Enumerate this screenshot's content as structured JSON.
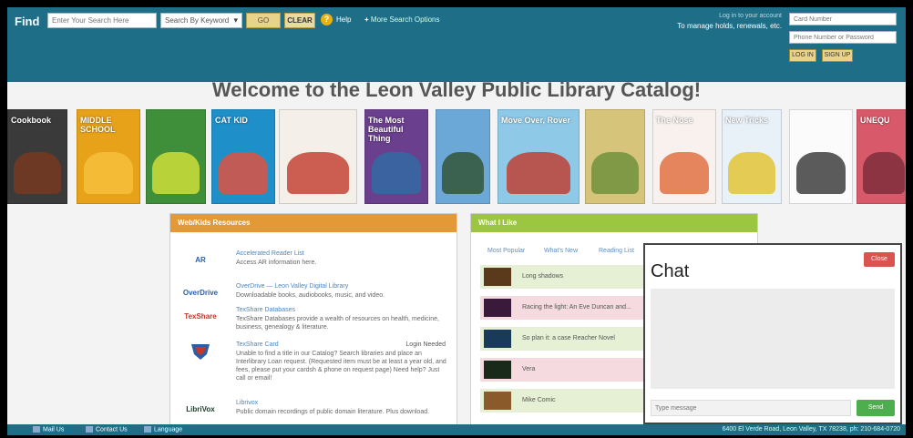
{
  "header": {
    "find_label": "Find",
    "search_placeholder": "Enter Your Search Here",
    "search_by": "Search By Keyword",
    "go_label": "GO",
    "clear_label": "CLEAR",
    "help_label": "Help",
    "more_search_label": "More Search Options",
    "account_line1": "Log in to your account",
    "account_line2": "To manage holds, renewals, etc.",
    "user_placeholder": "Card Number",
    "pass_placeholder": "Phone Number or Password",
    "login_label": "LOG IN",
    "signup_label": "SIGN UP"
  },
  "welcome": "Welcome to the Leon Valley Public Library Catalog!",
  "books": [
    {
      "title": "Cookbook",
      "color": "#3a3a3a",
      "accent": "#7a3a20"
    },
    {
      "title": "MIDDLE SCHOOL",
      "color": "#e8a21a",
      "accent": "#f6c23e"
    },
    {
      "title": "",
      "color": "#3f8f3a",
      "accent": "#d7e23a"
    },
    {
      "title": "CAT KID",
      "color": "#1f8fc9",
      "accent": "#e94e3a"
    },
    {
      "title": "",
      "color": "#f4efe8",
      "accent": "#c0392b"
    },
    {
      "title": "The Most Beautiful Thing",
      "color": "#6a3f8e",
      "accent": "#2e6da4"
    },
    {
      "title": "",
      "color": "#6ba8d8",
      "accent": "#2f4f2f"
    },
    {
      "title": "Move Over, Rover",
      "color": "#8fc9e8",
      "accent": "#c0392b"
    },
    {
      "title": "",
      "color": "#d6c47a",
      "accent": "#6a8f3a"
    },
    {
      "title": "The Nose",
      "color": "#f8f1ee",
      "accent": "#e06a3a"
    },
    {
      "title": "New Tricks",
      "color": "#e8f0f8",
      "accent": "#e2c22a"
    },
    {
      "title": "",
      "color": "#fbfbfb",
      "accent": "#333333"
    },
    {
      "title": "UNEQU",
      "color": "#d85a6a",
      "accent": "#7a2a3a"
    }
  ],
  "resources": {
    "title": "Web/Kids Resources",
    "items": [
      {
        "name": "Accelerated Reader List",
        "desc": "Access AR information here.",
        "login": "",
        "logo": "AR",
        "logo_color": "#2a5ea8"
      },
      {
        "name": "OverDrive — Leon Valley Digital Library",
        "desc": "Downloadable books, audiobooks, music, and video.",
        "login": "",
        "logo": "OverDrive",
        "logo_color": "#2a5ea8"
      },
      {
        "name": "TexShare Databases",
        "desc": "TexShare Databases provide a wealth of resources on health, medicine, business, genealogy & literature.",
        "login": "",
        "logo": "TexShare",
        "logo_color": "#c0392b"
      },
      {
        "name": "TexShare Card",
        "desc": "Unable to find a title in our Catalog? Search libraries and place an Interlibrary Loan request. (Requested item must be at least a year old, and fees, please put your cardsh & phone on request page) Need help? Just call or email!",
        "login": "Login Needed",
        "logo": "",
        "logo_color": "#2a5ea8"
      },
      {
        "name": "Librivox",
        "desc": "Public domain recordings of public domain literature. Plus download.",
        "login": "",
        "logo": "LibriVox",
        "logo_color": "#1a3a2a"
      }
    ]
  },
  "whats_new": {
    "title": "What I Like",
    "tabs": [
      "Most Popular",
      "What's New",
      "Reading List"
    ],
    "items": [
      {
        "title": "Long shadows",
        "thumb": "#5a3a1a"
      },
      {
        "title": "Racing the light: An Eve Duncan and...",
        "thumb": "#3a1a3a"
      },
      {
        "title": "So plan it: a case Reacher Novel",
        "thumb": "#1a3a5a"
      },
      {
        "title": "Vera",
        "thumb": "#1a2a1a"
      },
      {
        "title": "Mike Comic",
        "thumb": "#8a5a2a"
      }
    ]
  },
  "chat": {
    "title": "Chat",
    "close_label": "Close",
    "input_placeholder": "Type message",
    "send_label": "Send"
  },
  "footer": {
    "links": [
      "Mail Us",
      "Contact Us",
      "Language"
    ],
    "address": "6400 El Verde Road, Leon Valley, TX 78238, ph: 210-684-0720"
  }
}
